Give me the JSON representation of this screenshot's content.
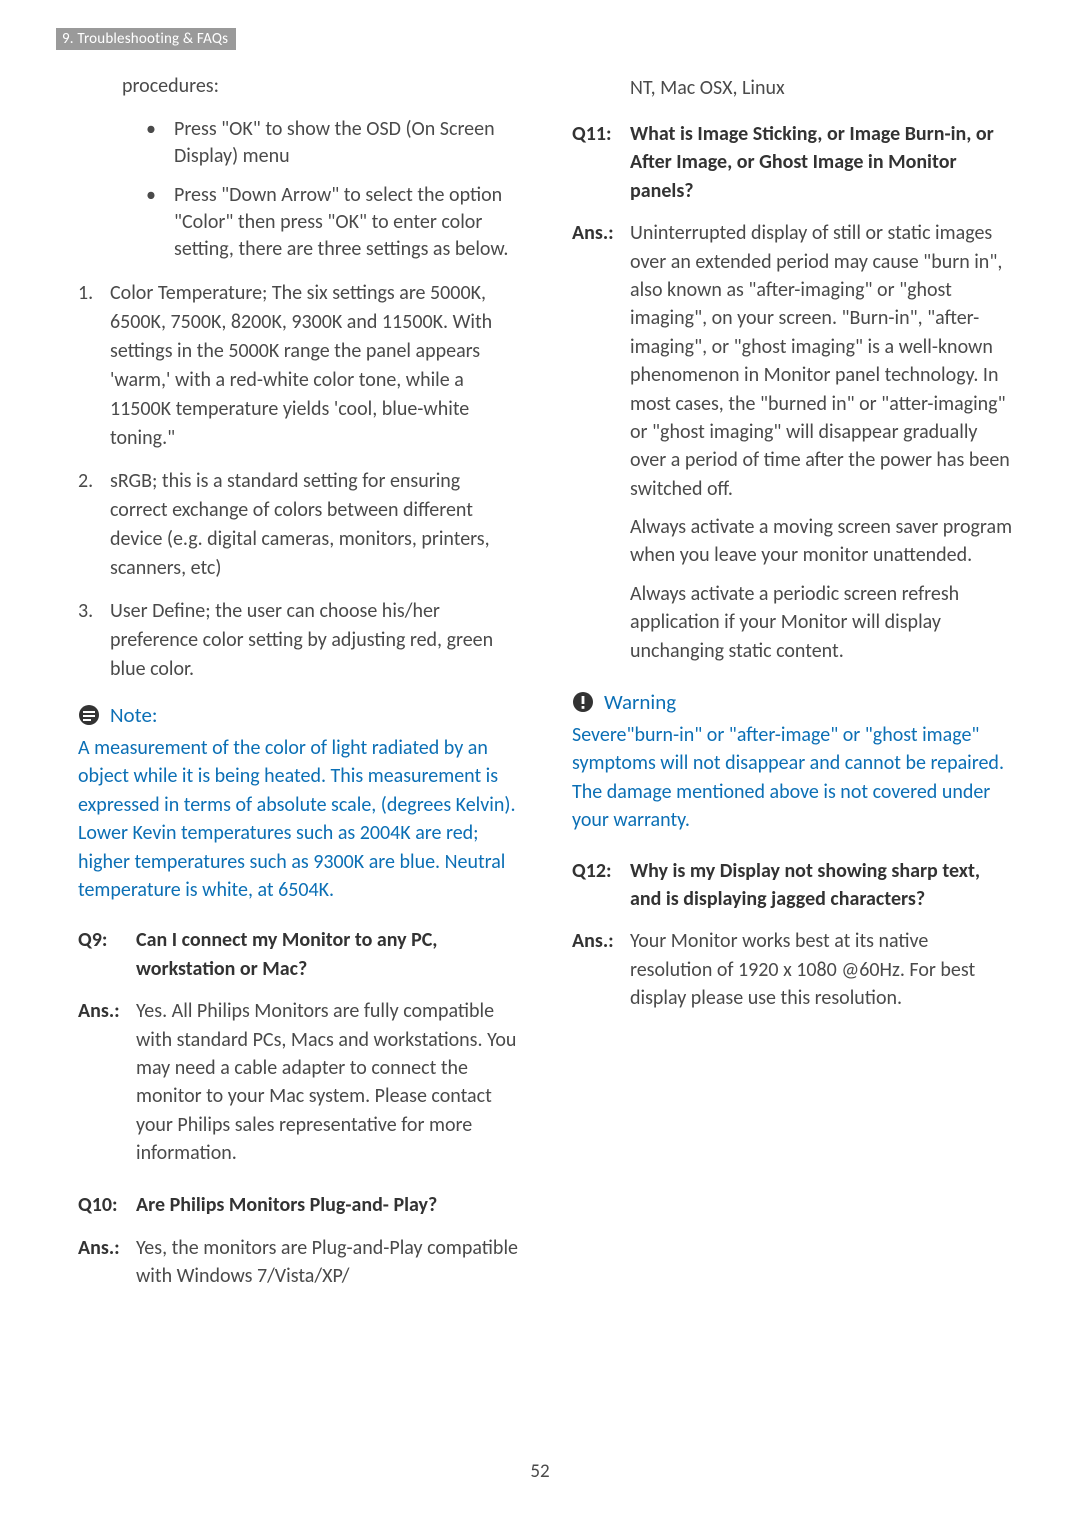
{
  "section_tab": "9. Troubleshooting & FAQs",
  "left": {
    "procedures_label": "procedures:",
    "bullets": [
      "Press \"OK\" to show the OSD (On Screen Display) menu",
      "Press \"Down Arrow\" to select the option \"Color\" then press \"OK\" to enter color setting, there are three settings as below."
    ],
    "numbered": [
      "Color Temperature; The six settings are 5000K, 6500K, 7500K, 8200K, 9300K and 11500K. With settings in the 5000K range the panel appears 'warm,' with a red-white color tone, while a 11500K temperature yields 'cool, blue-white toning.\"",
      "sRGB; this is a standard setting for ensuring correct exchange of colors between different device (e.g. digital cameras, monitors, printers, scanners, etc)",
      "User Define; the user can choose his/her preference color setting by adjusting red, green blue color."
    ],
    "note_title": "Note:",
    "note_body": "A measurement of the color of light radiated by an object while it is being heated. This measurement is expressed in terms of absolute scale, (degrees Kelvin). Lower Kevin temperatures such as 2004K are red; higher temperatures such as 9300K are blue. Neutral temperature is white, at 6504K.",
    "q9_label": "Q9:",
    "q9_text": "Can I connect my Monitor to any PC, workstation or Mac?",
    "a9_label": "Ans.:",
    "a9_text": "Yes. All Philips Monitors are fully compatible with standard PCs, Macs and workstations. You may need a cable adapter to connect the monitor to your Mac system. Please contact your Philips sales representative for more information.",
    "q10_label": "Q10:",
    "q10_text": "Are Philips Monitors Plug-and- Play?",
    "a10_label": "Ans.:",
    "a10_text": "Yes, the monitors are Plug-and-Play compatible with Windows 7/Vista/XP/"
  },
  "right": {
    "a10_cont": "NT, Mac OSX, Linux",
    "q11_label": "Q11:",
    "q11_text": "What is Image Sticking, or Image Burn-in, or After Image, or Ghost Image in Monitor panels?",
    "a11_label": "Ans.:",
    "a11_p1": "Uninterrupted display of still or static images over an extended period may cause \"burn in\", also known as \"after-imaging\" or \"ghost imaging\", on your screen. \"Burn-in\", \"after-imaging\", or \"ghost imaging\" is a well-known phenomenon in Monitor panel technology. In most cases, the \"burned in\" or \"atter-imaging\" or \"ghost imaging\" will disappear gradually over a period of time after the power has been switched off.",
    "a11_p2": "Always activate a moving screen saver program when you leave your monitor unattended.",
    "a11_p3": "Always activate a periodic screen refresh application if your Monitor will display unchanging static content.",
    "warning_title": "Warning",
    "warning_body": "Severe\"burn-in\" or \"after-image\" or \"ghost image\" symptoms will not disappear and cannot be repaired. The damage mentioned above is not covered under your warranty.",
    "q12_label": "Q12:",
    "q12_text": "Why is my Display not showing sharp text, and is displaying jagged characters?",
    "a12_label": "Ans.:",
    "a12_text": "Your Monitor works best at its native resolution of 1920 x 1080 @60Hz. For best display please use this resolution."
  },
  "page_number": "52"
}
